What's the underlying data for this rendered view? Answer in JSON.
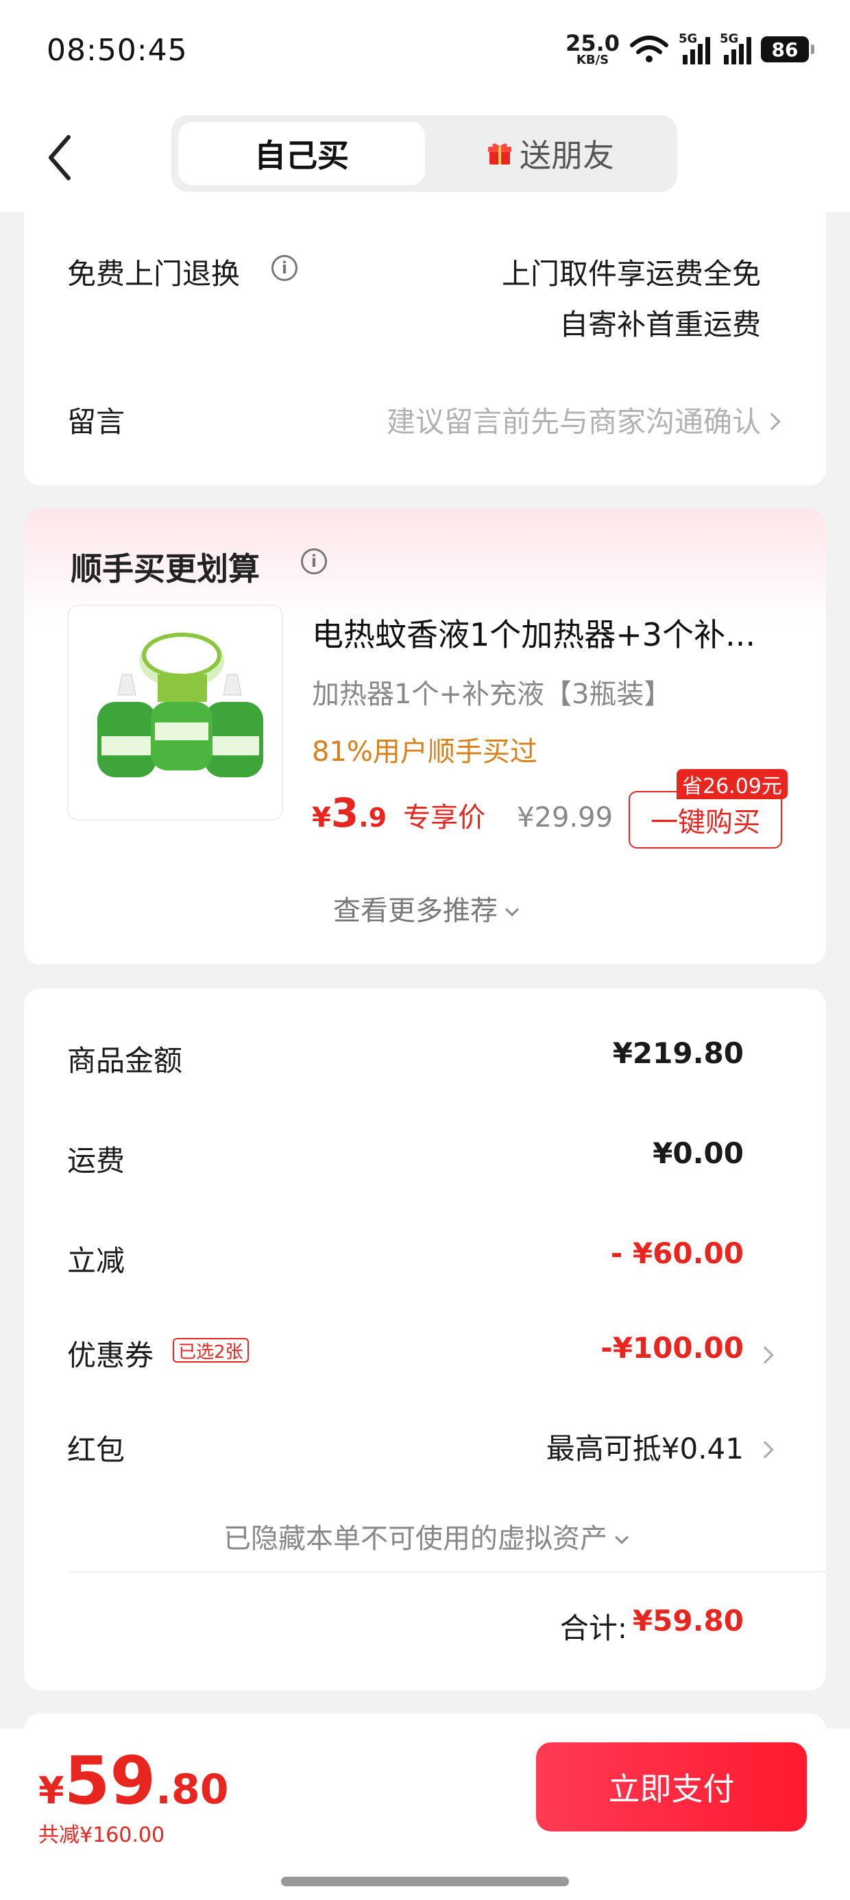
{
  "status": {
    "time": "08:50:45",
    "net_speed": "25.0",
    "net_unit": "KB/S",
    "sig1": "5G",
    "sig2": "5G",
    "battery": "86"
  },
  "header": {
    "tab_self": "自己买",
    "tab_gift": "送朋友"
  },
  "service": {
    "return_label": "免费上门退换",
    "return_line1": "上门取件享运费全免",
    "return_line2": "自寄补首重运费",
    "message_label": "留言",
    "message_placeholder": "建议留言前先与商家沟通确认"
  },
  "addon": {
    "title": "顺手买更划算",
    "product_title": "电热蚊香液1个加热器+3个补...",
    "spec": "加热器1个+补充液【3瓶装】",
    "social": "81%用户顺手买过",
    "price_currency": "¥",
    "price_int": "3",
    "price_dec": ".9",
    "price_tag": "专享价",
    "orig_price": "¥29.99",
    "save_badge": "省26.09元",
    "buy_button": "一键购买",
    "more": "查看更多推荐"
  },
  "summary": {
    "goods_label": "商品金额",
    "goods_value": "¥219.80",
    "shipping_label": "运费",
    "shipping_value": "¥0.00",
    "discount_label": "立减",
    "discount_value": "- ¥60.00",
    "coupon_label": "优惠券",
    "coupon_badge": "已选2张",
    "coupon_value": "-¥100.00",
    "redpack_label": "红包",
    "redpack_value": "最高可抵¥0.41",
    "hidden_note": "已隐藏本单不可使用的虚拟资产",
    "total_label": "合计:",
    "total_value": "¥59.80"
  },
  "pay": {
    "currency": "¥",
    "int": "59",
    "dec": ".80",
    "saved": "共减¥160.00",
    "button": "立即支付"
  },
  "colors": {
    "accent_red": "#e8261f",
    "social_orange": "#d9801b"
  }
}
